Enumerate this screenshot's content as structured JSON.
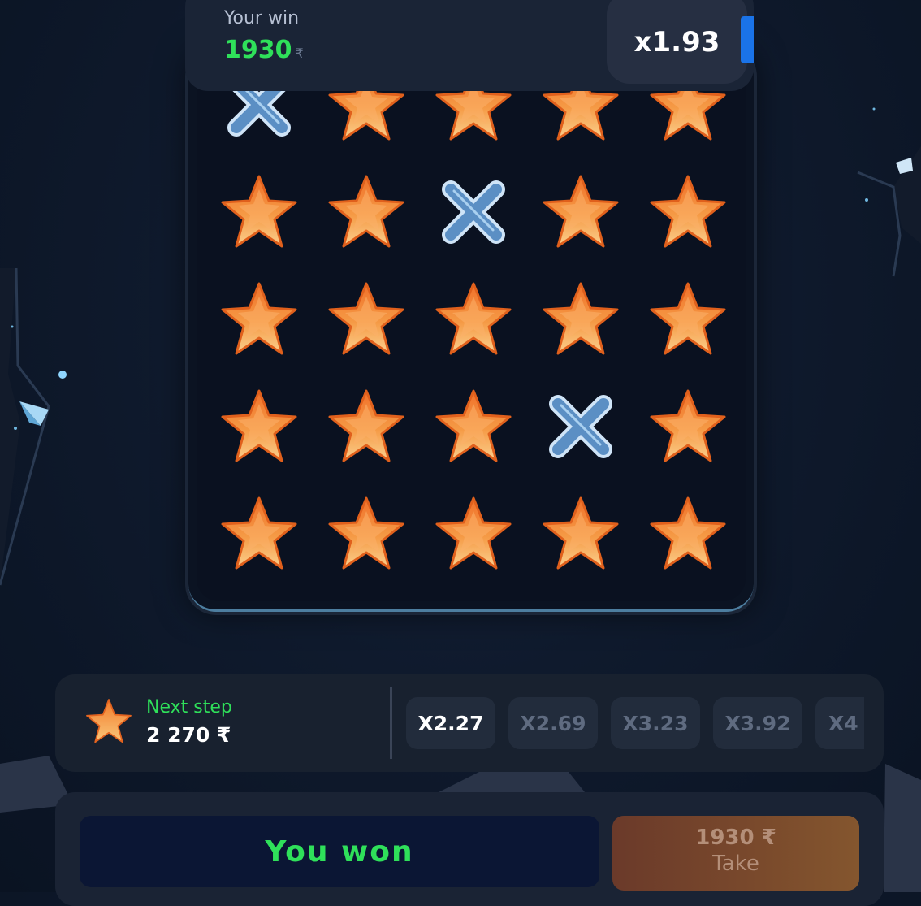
{
  "header": {
    "win_label": "Your win",
    "win_amount": "1930",
    "currency": "₹",
    "multiplier": "x1.93"
  },
  "board": {
    "rows": 5,
    "cols": 5,
    "cells": [
      [
        "x",
        "star",
        "star",
        "star",
        "star"
      ],
      [
        "star",
        "star",
        "x",
        "star",
        "star"
      ],
      [
        "star",
        "star",
        "star",
        "star",
        "star"
      ],
      [
        "star",
        "star",
        "star",
        "x",
        "star"
      ],
      [
        "star",
        "star",
        "star",
        "star",
        "star"
      ]
    ]
  },
  "next_step": {
    "label": "Next step",
    "value": "2 270 ₹",
    "icon": "star-icon"
  },
  "multipliers": [
    {
      "label": "X2.27",
      "active": true
    },
    {
      "label": "X2.69",
      "active": false
    },
    {
      "label": "X3.23",
      "active": false
    },
    {
      "label": "X3.92",
      "active": false
    },
    {
      "label": "X4",
      "active": false
    }
  ],
  "result": {
    "status_text": "You won",
    "take_amount": "1930 ₹",
    "take_label": "Take"
  },
  "colors": {
    "accent_green": "#2fe05a",
    "star_orange": "#f08a2c",
    "accent_blue": "#1a73e8"
  }
}
